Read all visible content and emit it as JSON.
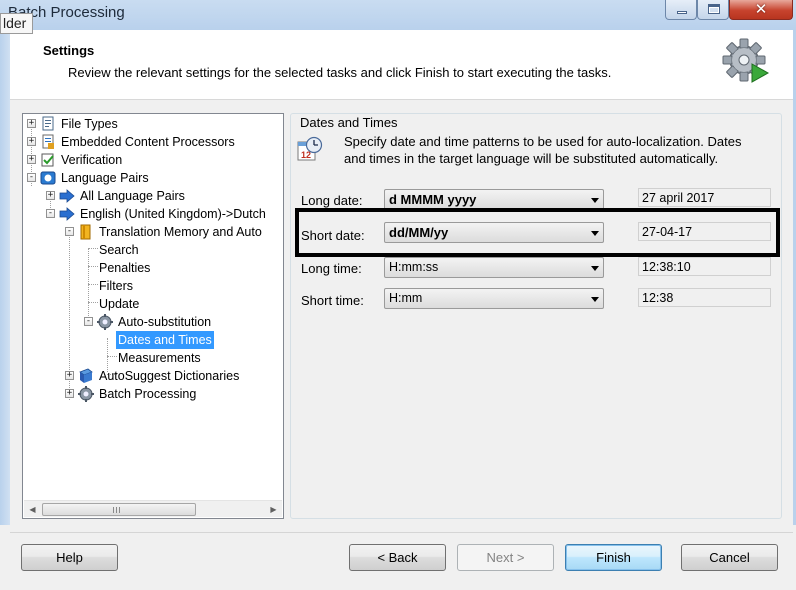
{
  "window": {
    "title": "Batch Processing",
    "tooltip_fragment": "lder",
    "controls": {
      "minimize": "minimize-icon",
      "maximize": "maximize-icon",
      "close": "close-icon"
    }
  },
  "header": {
    "title": "Settings",
    "subtitle": "Review the relevant settings for the selected tasks and click Finish to start executing the tasks.",
    "icon": "gear-play-icon"
  },
  "tree": {
    "items": [
      {
        "label": "File Types",
        "icon": "file-types-icon",
        "expander": "+"
      },
      {
        "label": "Embedded Content Processors",
        "icon": "document-icon",
        "expander": "+"
      },
      {
        "label": "Verification",
        "icon": "verification-icon",
        "expander": "+"
      },
      {
        "label": "Language Pairs",
        "icon": "language-pairs-icon",
        "expander": "-"
      },
      {
        "label": "All Language Pairs",
        "icon": "arrow-icon",
        "expander": "+"
      },
      {
        "label": "English (United Kingdom)->Dutch",
        "icon": "arrow-icon",
        "expander": "-"
      },
      {
        "label": "Translation Memory and Auto",
        "icon": "tm-icon",
        "expander": "-"
      },
      {
        "label": "Search"
      },
      {
        "label": "Penalties"
      },
      {
        "label": "Filters"
      },
      {
        "label": "Update"
      },
      {
        "label": "Auto-substitution",
        "icon": "gear-icon",
        "expander": "-"
      },
      {
        "label": "Dates and Times",
        "selected": true
      },
      {
        "label": "Measurements"
      },
      {
        "label": "AutoSuggest Dictionaries",
        "icon": "book-icon",
        "expander": "+"
      },
      {
        "label": "Batch Processing",
        "icon": "gear-icon",
        "expander": "+"
      }
    ]
  },
  "panel": {
    "group_title": "Dates and Times",
    "description": "Specify date and time patterns to be used for auto-localization. Dates and times in the target language will be substituted automatically.",
    "fields": [
      {
        "label": "Long date:",
        "value": "d MMMM yyyy",
        "preview": "27 april 2017"
      },
      {
        "label": "Short date:",
        "value": "dd/MM/yy",
        "preview": "27-04-17"
      },
      {
        "label": "Long time:",
        "value": "H:mm:ss",
        "preview": "12:38:10"
      },
      {
        "label": "Short time:",
        "value": "H:mm",
        "preview": "12:38"
      }
    ]
  },
  "footer": {
    "help": "Help",
    "back": "< Back",
    "next": "Next >",
    "finish": "Finish",
    "cancel": "Cancel"
  }
}
